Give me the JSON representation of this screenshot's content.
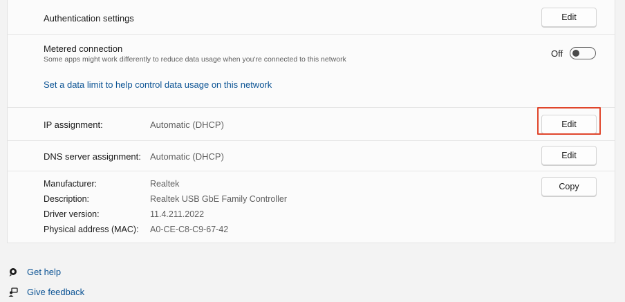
{
  "auth": {
    "label": "Authentication settings",
    "edit_label": "Edit"
  },
  "metered": {
    "title": "Metered connection",
    "description": "Some apps might work differently to reduce data usage when you're connected to this network",
    "toggle_state": "Off",
    "toggle_on": false,
    "data_limit_link": "Set a data limit to help control data usage on this network"
  },
  "ip": {
    "label": "IP assignment:",
    "value": "Automatic (DHCP)",
    "edit_label": "Edit"
  },
  "dns": {
    "label": "DNS server assignment:",
    "value": "Automatic (DHCP)",
    "edit_label": "Edit"
  },
  "properties": {
    "copy_label": "Copy",
    "items": [
      {
        "label": "Manufacturer:",
        "value": "Realtek"
      },
      {
        "label": "Description:",
        "value": "Realtek USB GbE Family Controller"
      },
      {
        "label": "Driver version:",
        "value": "11.4.211.2022"
      },
      {
        "label": "Physical address (MAC):",
        "value": "A0-CE-C8-C9-67-42"
      }
    ]
  },
  "help": {
    "get_help": "Get help",
    "give_feedback": "Give feedback",
    "get_help_icon": "help-chat-icon",
    "give_feedback_icon": "feedback-icon"
  },
  "colors": {
    "highlight": "#e0452b",
    "link": "#0b5394"
  }
}
